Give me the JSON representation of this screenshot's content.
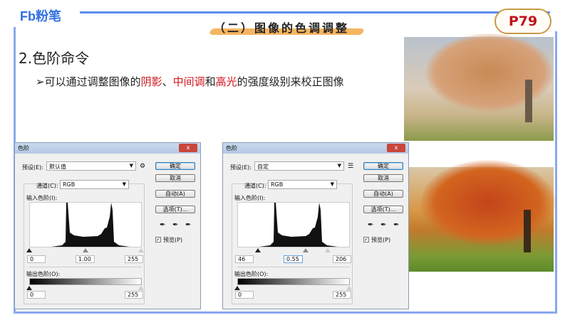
{
  "header": {
    "logo": "Fb粉笔",
    "section_title": "（二）图像的色调调整",
    "page_badge": "P79"
  },
  "content": {
    "heading": "2.色阶命令",
    "bullet_pre": "可以通过调整图像的",
    "bullet_r1": "阴影",
    "bullet_sep": "、",
    "bullet_r2": "中间调",
    "bullet_and": "和",
    "bullet_r3": "高光",
    "bullet_post": "的强度级别来校正图像",
    "bullet_marker": "➢"
  },
  "dialogs": [
    {
      "title": "色阶",
      "close": "x",
      "preset_label": "预设(E):",
      "preset_value": "默认值",
      "preset_icon": "gear-icon",
      "channel_label": "通道(C):",
      "channel_value": "RGB",
      "input_label": "输入色阶(I):",
      "input_black": "0",
      "input_mid": "1.00",
      "input_white": "255",
      "output_label": "输出色阶(O):",
      "output_black": "0",
      "output_white": "255",
      "ok": "确定",
      "cancel": "取消",
      "auto": "自动(A)",
      "options": "选项(T)...",
      "preview": "预览(P)",
      "preview_checked": true
    },
    {
      "title": "色阶",
      "close": "x",
      "preset_label": "预设(E):",
      "preset_value": "自定",
      "preset_icon": "list-icon",
      "channel_label": "通道(C):",
      "channel_value": "RGB",
      "input_label": "输入色阶(I):",
      "input_black": "46",
      "input_mid": "0.55",
      "input_white": "206",
      "output_label": "输出色阶(O):",
      "output_black": "0",
      "output_white": "255",
      "ok": "确定",
      "cancel": "取消",
      "auto": "自动(A)",
      "options": "选项(T)...",
      "preview": "预览(P)",
      "preview_checked": true
    }
  ],
  "colors": {
    "accent": "#5b8def",
    "highlight": "#d0161e",
    "badge": "#c0121a"
  }
}
